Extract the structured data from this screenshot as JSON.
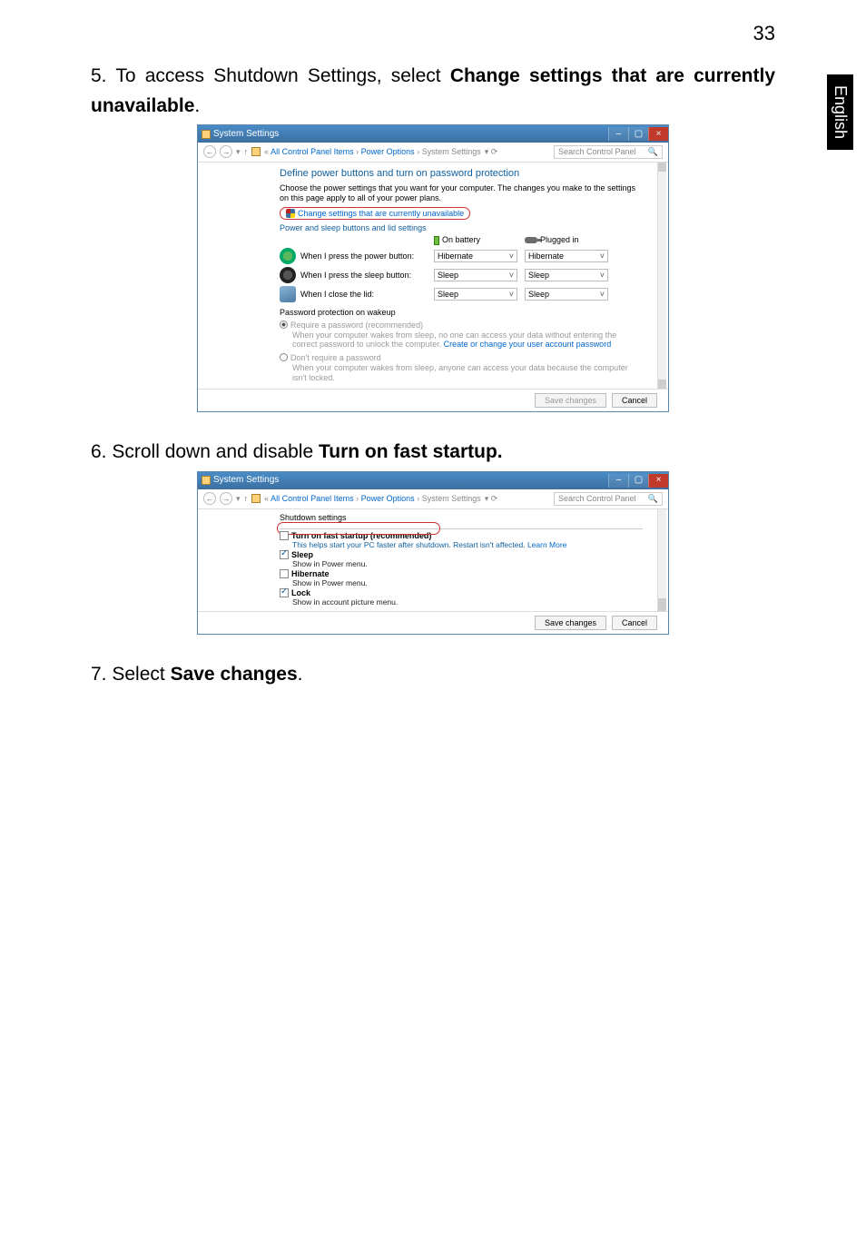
{
  "page_number": "33",
  "side_tab": "English",
  "steps": {
    "s5a": "5. To access Shutdown Settings, select ",
    "s5b": "Change settings that are currently unavailable",
    "s5c": ".",
    "s6a": "6. Scroll down and disable ",
    "s6b": "Turn on fast startup.",
    "s7a": "7. Select ",
    "s7b": "Save changes",
    "s7c": "."
  },
  "win1": {
    "title": "System Settings",
    "min": "–",
    "max": "▢",
    "close": "×",
    "nav_back": "←",
    "nav_fwd": "→",
    "nav_up": "↑",
    "crumb_pre": "«",
    "crumb1": "All Control Panel Items",
    "crumb_sep": "›",
    "crumb2": "Power Options",
    "crumb3": "System Settings",
    "refresh": "⟳",
    "search_placeholder": "Search Control Panel",
    "search_glyph": "🔍",
    "sec_title": "Define power buttons and turn on password protection",
    "sec_body": "Choose the power settings that you want for your computer. The changes you make to the settings on this page apply to all of your power plans.",
    "link_change": "Change settings that are currently unavailable",
    "sub_buttons": "Power and sleep buttons and lid settings",
    "hdr_batt": "On battery",
    "hdr_plug": "Plugged in",
    "rows": [
      {
        "label": "When I press the power button:",
        "batt": "Hibernate",
        "plug": "Hibernate"
      },
      {
        "label": "When I press the sleep button:",
        "batt": "Sleep",
        "plug": "Sleep"
      },
      {
        "label": "When I close the lid:",
        "batt": "Sleep",
        "plug": "Sleep"
      }
    ],
    "pp_title": "Password protection on wakeup",
    "r1_label": "Require a password (recommended)",
    "r1_body1": "When your computer wakes from sleep, no one can access your data without entering the correct password to unlock the computer. ",
    "r1_link": "Create or change your user account password",
    "r2_label": "Don't require a password",
    "r2_body": "When your computer wakes from sleep, anyone can access your data because the computer isn't locked.",
    "btn_save": "Save changes",
    "btn_cancel": "Cancel"
  },
  "win2": {
    "title": "System Settings",
    "min": "–",
    "max": "▢",
    "close": "×",
    "nav_back": "←",
    "nav_fwd": "→",
    "nav_up": "↑",
    "crumb_pre": "«",
    "crumb1": "All Control Panel Items",
    "crumb_sep": "›",
    "crumb2": "Power Options",
    "crumb3": "System Settings",
    "refresh": "⟳",
    "search_placeholder": "Search Control Panel",
    "search_glyph": "🔍",
    "group": "Shutdown settings",
    "op1": "Turn on fast startup (recommended)",
    "op1_desc_a": "This helps start your PC faster after shutdown. Restart isn't affected. ",
    "op1_desc_b": "Learn More",
    "op2": "Sleep",
    "op2_desc": "Show in Power menu.",
    "op3": "Hibernate",
    "op3_desc": "Show in Power menu.",
    "op4": "Lock",
    "op4_desc": "Show in account picture menu.",
    "btn_save": "Save changes",
    "btn_cancel": "Cancel"
  }
}
